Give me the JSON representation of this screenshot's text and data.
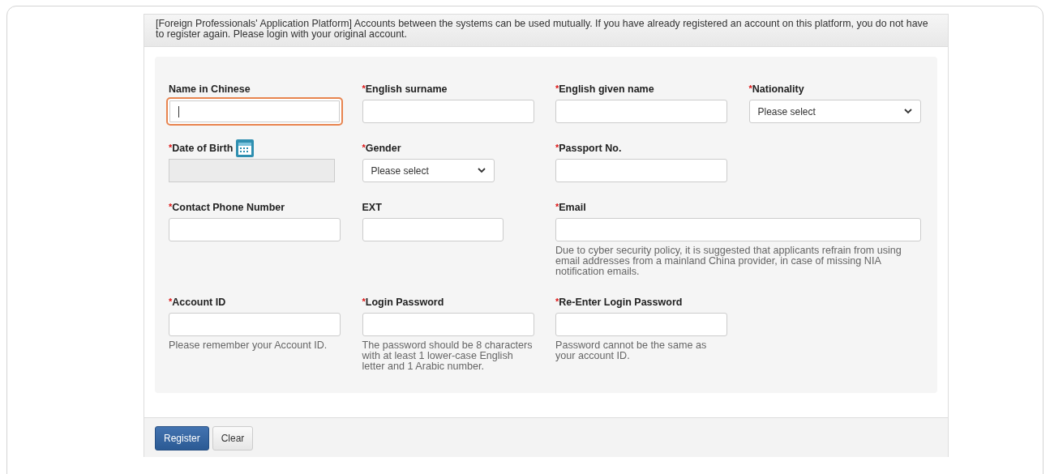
{
  "notice": "[Foreign Professionals' Application Platform] Accounts between the systems can be used mutually. If you have already registered an account on this platform, you do not have to register again. Please login with your original account.",
  "rows": [
    [
      {
        "label": "Name in Chinese",
        "kind": "text",
        "focused": true
      },
      {
        "required_mark": "*",
        "label": "English surname",
        "kind": "text",
        "focused": false
      },
      {
        "required_mark": "*",
        "label": "English given name",
        "kind": "text",
        "focused": false
      },
      {
        "required_mark": "*",
        "label": "Nationality",
        "kind": "select",
        "value": "Please select"
      }
    ],
    [
      {
        "required_mark": "*",
        "label": "Date of Birth",
        "kind": "date",
        "disabled": true
      },
      {
        "required_mark": "*",
        "label": "Gender",
        "kind": "select",
        "value": "Please select"
      },
      {
        "required_mark": "*",
        "label": "Passport No.",
        "kind": "text",
        "focused": false
      }
    ],
    [
      {
        "required_mark": "*",
        "label": "Contact Phone Number",
        "kind": "text",
        "focused": false
      },
      {
        "label": "EXT",
        "kind": "text",
        "focused": false
      },
      {
        "required_mark": "*",
        "label": "Email",
        "kind": "text",
        "focused": false,
        "help": "Due to cyber security policy, it is suggested that applicants refrain from using email addresses from a mainland China provider, in case of missing NIA notification emails."
      }
    ],
    [
      {
        "required_mark": "*",
        "label": "Account ID",
        "kind": "text",
        "focused": false,
        "help": "Please remember your Account ID."
      },
      {
        "required_mark": "*",
        "label": "Login Password",
        "kind": "text",
        "focused": false,
        "help": "The password should be 8 characters with at least 1 lower-case English letter and 1 Arabic number."
      },
      {
        "required_mark": "*",
        "label": "Re-Enter Login Password",
        "kind": "text",
        "focused": false,
        "help": "Password cannot be the same as your account ID."
      }
    ]
  ],
  "buttons": [
    {
      "label": "Register",
      "kind": "primary"
    },
    {
      "label": "Clear",
      "kind": "default"
    }
  ]
}
